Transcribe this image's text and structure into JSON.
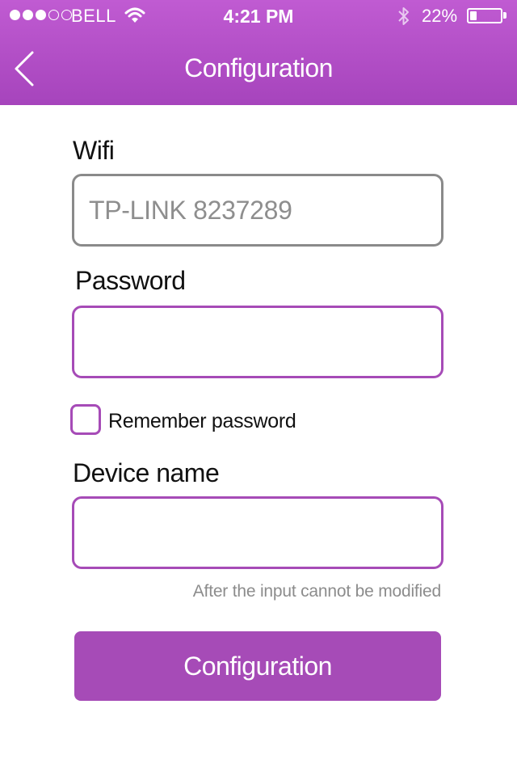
{
  "status_bar": {
    "carrier": "BELL",
    "signal_bars_filled": 3,
    "signal_bars_total": 5,
    "time": "4:21 PM",
    "battery_percent": "22%",
    "battery_level": 0.22,
    "icons": [
      "wifi-icon",
      "bluetooth-icon",
      "battery-icon"
    ]
  },
  "nav": {
    "title": "Configuration",
    "back_icon": "chevron-left-icon"
  },
  "form": {
    "wifi_label": "Wifi",
    "wifi_value": "TP-LINK 8237289",
    "password_label": "Password",
    "password_value": "",
    "remember_label": "Remember password",
    "remember_checked": false,
    "device_name_label": "Device name",
    "device_name_value": "",
    "device_name_hint": "After the input cannot be modified",
    "submit_label": "Configuration"
  },
  "colors": {
    "header_gradient_top": "#c05bd2",
    "header_gradient_bottom": "#a644bc",
    "accent": "#a64bb7",
    "wifi_border": "#8a8a8a",
    "hint_text": "#8c8c8c"
  }
}
